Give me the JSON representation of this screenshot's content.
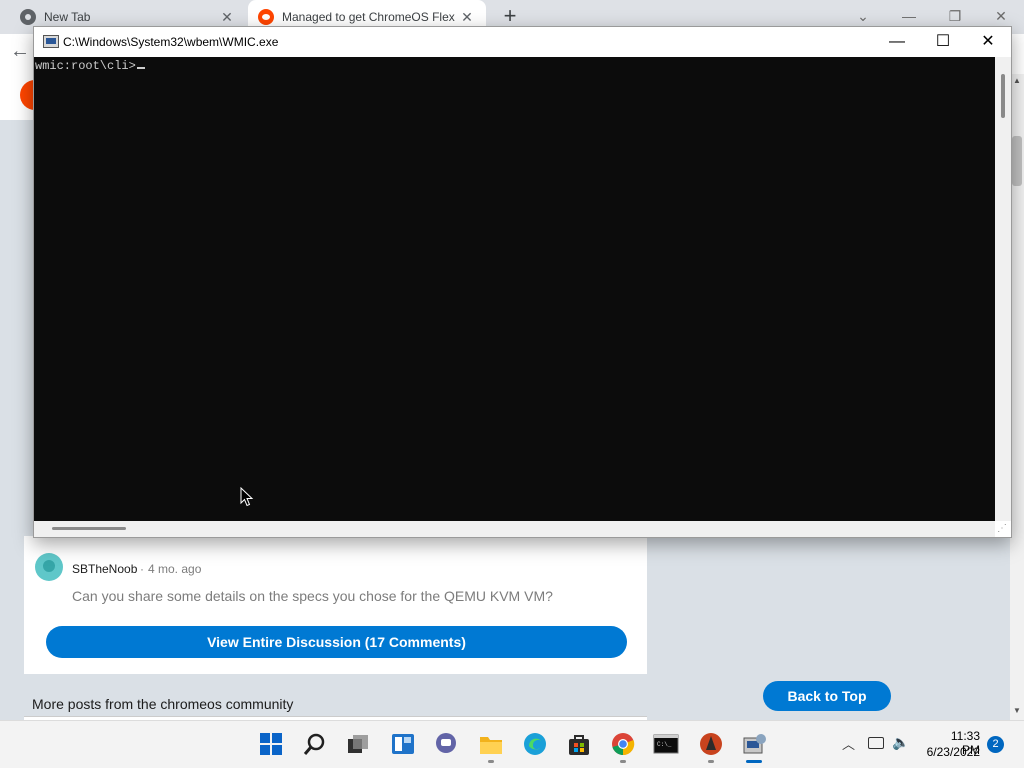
{
  "browser": {
    "tabs": [
      {
        "title": "New Tab",
        "close": "✕"
      },
      {
        "title": "Managed to get ChromeOS Flex",
        "close": "✕"
      }
    ],
    "new_tab": "+",
    "controls": {
      "menu": "⌄",
      "minimize": "—",
      "restore": "❐",
      "close": "✕"
    }
  },
  "console": {
    "title": "C:\\Windows\\System32\\wbem\\WMIC.exe",
    "prompt": "wmic:root\\cli>",
    "controls": {
      "minimize": "—",
      "maximize": "☐",
      "close": "✕"
    }
  },
  "comment": {
    "user": "SBTheNoob",
    "separator": "·",
    "time": "4 mo. ago",
    "text": "Can you share some details on the specs you chose for the QEMU KVM VM?"
  },
  "buttons": {
    "view_discussion": "View Entire Discussion (17 Comments)",
    "back_to_top": "Back to Top"
  },
  "more_posts": "More posts from the chromeos community",
  "taskbar": {
    "items": [
      "start-icon",
      "search-icon",
      "task-view-icon",
      "widgets-icon",
      "chat-icon",
      "file-explorer-icon",
      "edge-icon",
      "store-icon",
      "chrome-icon",
      "terminal-icon",
      "app-icon",
      "wmic-icon"
    ],
    "time": "11:33 PM",
    "date": "6/23/2022",
    "notifications": "2"
  },
  "colors": {
    "accent": "#0079d3",
    "console_bg": "#0c0c0c",
    "reddit": "#ff4500",
    "taskbar_active": "#0067c0"
  }
}
